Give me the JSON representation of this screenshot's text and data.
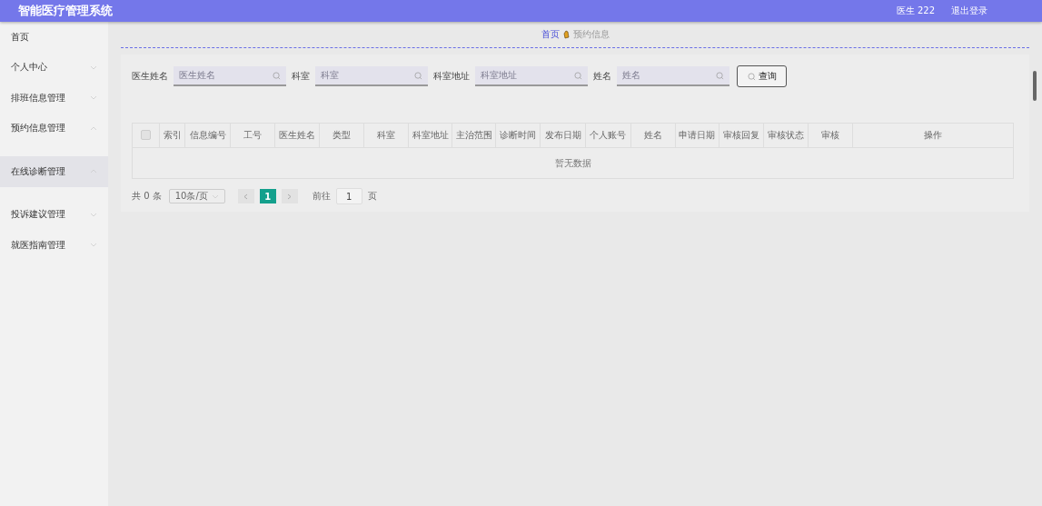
{
  "header": {
    "title": "智能医疗管理系统",
    "user": "医生 222",
    "logout": "退出登录"
  },
  "sidebar": {
    "items": [
      {
        "label": "首页",
        "has_arrow": false,
        "expanded": false,
        "selected": false
      },
      {
        "label": "个人中心",
        "has_arrow": true,
        "expanded": false,
        "selected": false
      },
      {
        "label": "排班信息管理",
        "has_arrow": true,
        "expanded": false,
        "selected": false
      },
      {
        "label": "预约信息管理",
        "has_arrow": true,
        "expanded": true,
        "selected": false
      },
      {
        "label": "在线诊断管理",
        "has_arrow": true,
        "expanded": true,
        "selected": true
      },
      {
        "label": "投诉建议管理",
        "has_arrow": true,
        "expanded": false,
        "selected": false
      },
      {
        "label": "就医指南管理",
        "has_arrow": true,
        "expanded": false,
        "selected": false
      }
    ]
  },
  "breadcrumb": [
    {
      "label": "首页",
      "selected": true
    },
    {
      "label": "预约信息",
      "selected": false
    }
  ],
  "filters": [
    {
      "label": "医生姓名",
      "placeholder": "医生姓名"
    },
    {
      "label": "科室",
      "placeholder": "科室"
    },
    {
      "label": "科室地址",
      "placeholder": "科室地址"
    },
    {
      "label": "姓名",
      "placeholder": "姓名"
    }
  ],
  "search_button": "查询",
  "table": {
    "select_all": false,
    "columns": [
      "索引",
      "信息编号",
      "工号",
      "医生姓名",
      "类型",
      "科室",
      "科室地址",
      "主治范围",
      "诊断时间",
      "发布日期",
      "个人账号",
      "姓名",
      "申请日期",
      "审核回复",
      "审核状态",
      "审核",
      "操作"
    ],
    "empty_text": "暂无数据"
  },
  "pagination": {
    "total": "共 0 条",
    "page_size": "10条/页",
    "pages": [
      {
        "label": "1",
        "selected": true
      }
    ],
    "goto_label": "前往",
    "goto_value": "1",
    "goto_suffix": "页"
  }
}
